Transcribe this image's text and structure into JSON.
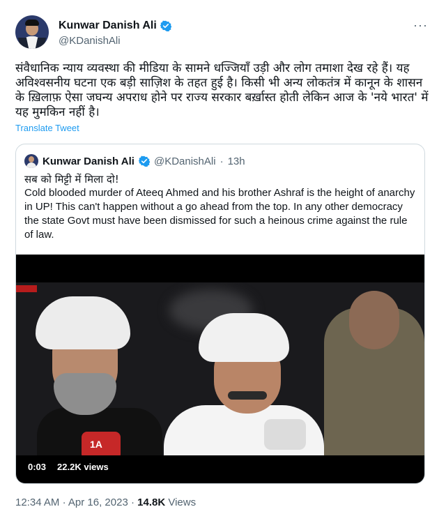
{
  "tweet": {
    "author_name": "Kunwar Danish Ali",
    "author_handle": "@KDanishAli",
    "more_label": "···",
    "text": "संवैधानिक न्याय व्यवस्था की मीडिया के सामने धज्जियाँ उड़ी और लोग तमाशा देख रहे हैं। यह अविश्वसनीय घटना एक बड़ी साज़िश के तहत हुई है। किसी भी अन्य लोकतंत्र में कानून के शासन के ख़िलाफ़ ऐसा जघन्य अपराध होने पर राज्य सरकार बर्ख़ास्त होती लेकिन आज के 'नये भारत' में यह मुमकिन नहीं है।",
    "translate_label": "Translate Tweet",
    "time": "12:34 AM",
    "separator": "·",
    "date": "Apr 16, 2023",
    "views_count": "14.8K",
    "views_label": "Views"
  },
  "quoted": {
    "author_name": "Kunwar Danish Ali",
    "author_handle": "@KDanishAli",
    "separator": "·",
    "age": "13h",
    "hindi_line": "सब को मिट्टी में मिला दो!",
    "english_text": "Cold blooded murder of Ateeq Ahmed and his brother Ashraf is the height of anarchy in UP! This can't happen without a go ahead from the top. In any other democracy the state Govt must have been dismissed for such a heinous crime against the rule of law.",
    "video": {
      "duration": "0:03",
      "views": "22.2K views",
      "mic_label": "1A"
    }
  },
  "colors": {
    "link": "#1d9bf0",
    "secondary_text": "#536471",
    "verified_badge": "#1d9bf0"
  },
  "icons": [
    "verified-badge-icon",
    "more-options-icon"
  ]
}
